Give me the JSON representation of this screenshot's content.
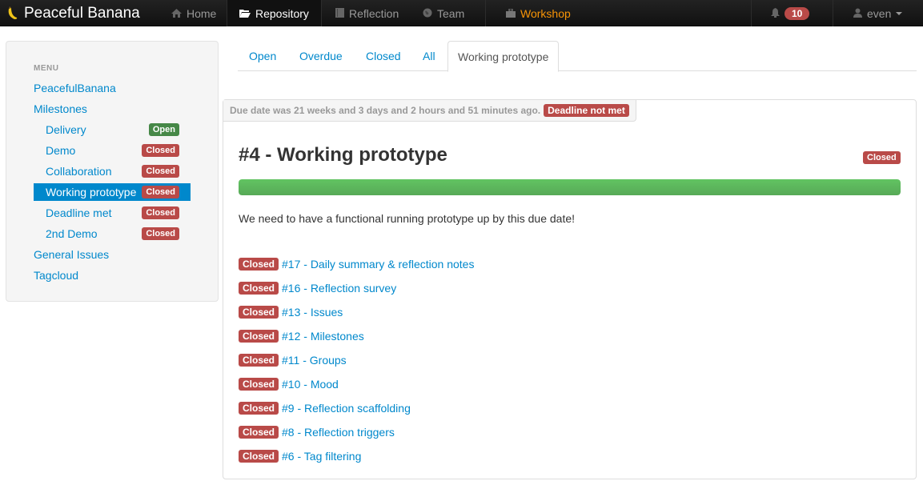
{
  "navbar": {
    "brand": "Peaceful Banana",
    "items": [
      {
        "label": "Home",
        "icon": "home-icon"
      },
      {
        "label": "Repository",
        "icon": "folder-open-icon"
      },
      {
        "label": "Reflection",
        "icon": "book-icon"
      },
      {
        "label": "Team",
        "icon": "globe-icon"
      },
      {
        "label": "Workshop",
        "icon": "briefcase-icon"
      }
    ],
    "notifications_count": "10",
    "user": "even"
  },
  "sidebar": {
    "header": "MENU",
    "links": [
      {
        "label": "PeacefulBanana"
      },
      {
        "label": "Milestones"
      },
      {
        "label": "Delivery",
        "badge": "Open"
      },
      {
        "label": "Demo",
        "badge": "Closed"
      },
      {
        "label": "Collaboration",
        "badge": "Closed"
      },
      {
        "label": "Working prototype",
        "badge": "Closed"
      },
      {
        "label": "Deadline met",
        "badge": "Closed"
      },
      {
        "label": "2nd Demo",
        "badge": "Closed"
      },
      {
        "label": "General Issues"
      },
      {
        "label": "Tagcloud"
      }
    ]
  },
  "tabs": [
    "Open",
    "Overdue",
    "Closed",
    "All",
    "Working prototype"
  ],
  "milestone": {
    "due_text": "Due date was 21 weeks and 3 days and 2 hours and 51 minutes ago.",
    "deadline_badge": "Deadline not met",
    "title": "#4 - Working prototype",
    "status": "Closed",
    "progress_percent": 100,
    "description": "We need to have a functional running prototype up by this due date!"
  },
  "issues": [
    {
      "status": "Closed",
      "title": "#17 - Daily summary & reflection notes"
    },
    {
      "status": "Closed",
      "title": "#16 - Reflection survey"
    },
    {
      "status": "Closed",
      "title": "#13 - Issues"
    },
    {
      "status": "Closed",
      "title": "#12 - Milestones"
    },
    {
      "status": "Closed",
      "title": "#11 - Groups"
    },
    {
      "status": "Closed",
      "title": "#10 - Mood"
    },
    {
      "status": "Closed",
      "title": "#9 - Reflection scaffolding"
    },
    {
      "status": "Closed",
      "title": "#8 - Reflection triggers"
    },
    {
      "status": "Closed",
      "title": "#6 - Tag filtering"
    }
  ],
  "colors": {
    "link": "#0088cc",
    "closed": "#b94a48",
    "open": "#468847",
    "progress": "#5eb95e",
    "workshop": "#f89406"
  }
}
